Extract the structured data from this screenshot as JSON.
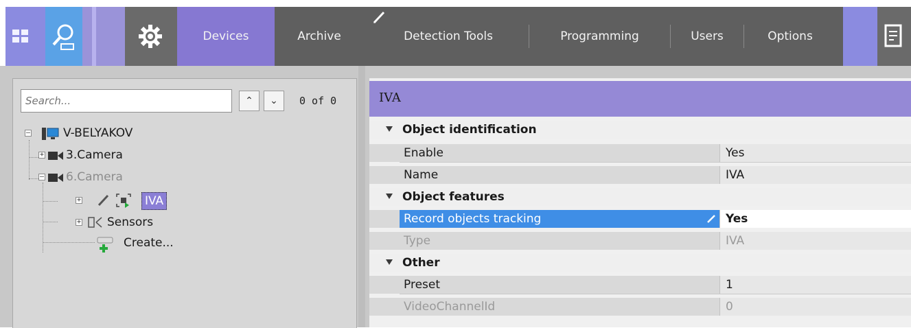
{
  "toolbar": {
    "tabs": [
      {
        "label": "Devices",
        "active": true
      },
      {
        "label": "Archive",
        "active": false
      },
      {
        "label": "Detection Tools",
        "active": false
      },
      {
        "label": "Programming",
        "active": false
      },
      {
        "label": "Users",
        "active": false
      },
      {
        "label": "Options",
        "active": false
      }
    ],
    "icons": [
      "layout-grid-icon",
      "search-archive-icon",
      "gear-icon",
      "pencil-icon",
      "report-icon"
    ]
  },
  "left_panel": {
    "search": {
      "placeholder": "Search...",
      "value": ""
    },
    "counter": "0 of 0",
    "tree": {
      "root": "V-BELYAKOV",
      "camera3": "3.Camera",
      "camera6": "6.Camera",
      "iva": "IVA",
      "sensors": "Sensors",
      "create": "Create..."
    }
  },
  "right_panel": {
    "title": "IVA",
    "categories": {
      "identification": "Object identification",
      "features": "Object features",
      "other": "Other"
    },
    "props": {
      "enable": {
        "name": "Enable",
        "value": "Yes"
      },
      "name": {
        "name": "Name",
        "value": "IVA"
      },
      "record": {
        "name": "Record objects tracking",
        "value": "Yes"
      },
      "type": {
        "name": "Type",
        "value": "IVA"
      },
      "preset": {
        "name": "Preset",
        "value": "1"
      },
      "videochannel": {
        "name": "VideoChannelId",
        "value": "0"
      }
    }
  },
  "colors": {
    "accent_violet": "#8678d2",
    "selection_blue": "#3f8ee6",
    "toolbar_gray": "#5f5f5f"
  }
}
